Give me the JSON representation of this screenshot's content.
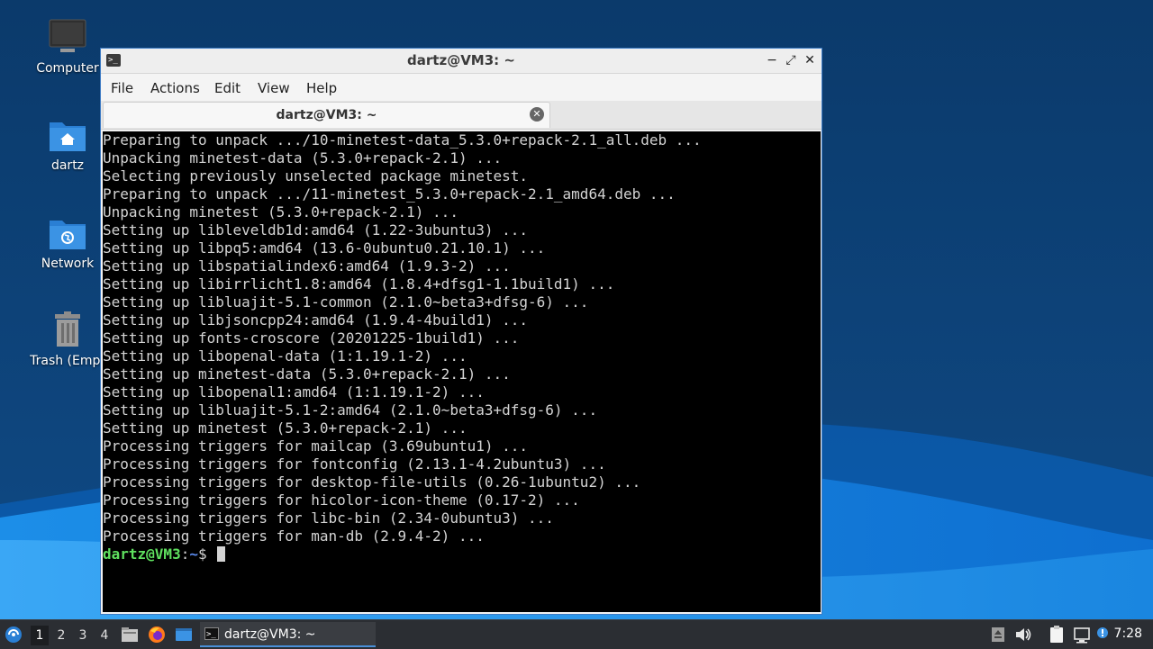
{
  "desktop": {
    "icons": [
      {
        "label": "Computer",
        "icon": "computer-icon"
      },
      {
        "label": "dartz",
        "icon": "home-folder-icon"
      },
      {
        "label": "Network",
        "icon": "network-folder-icon"
      },
      {
        "label": "Trash (Empt",
        "icon": "trash-icon"
      }
    ]
  },
  "window": {
    "title": "dartz@VM3: ~",
    "controls": {
      "minimize": "−",
      "maximize": "⤢",
      "close": "✕"
    },
    "menu": [
      "File",
      "Actions",
      "Edit",
      "View",
      "Help"
    ],
    "tab": {
      "label": "dartz@VM3: ~",
      "close": "✕"
    },
    "terminal": {
      "lines": [
        "Preparing to unpack .../10-minetest-data_5.3.0+repack-2.1_all.deb ...",
        "Unpacking minetest-data (5.3.0+repack-2.1) ...",
        "Selecting previously unselected package minetest.",
        "Preparing to unpack .../11-minetest_5.3.0+repack-2.1_amd64.deb ...",
        "Unpacking minetest (5.3.0+repack-2.1) ...",
        "Setting up libleveldb1d:amd64 (1.22-3ubuntu3) ...",
        "Setting up libpq5:amd64 (13.6-0ubuntu0.21.10.1) ...",
        "Setting up libspatialindex6:amd64 (1.9.3-2) ...",
        "Setting up libirrlicht1.8:amd64 (1.8.4+dfsg1-1.1build1) ...",
        "Setting up libluajit-5.1-common (2.1.0~beta3+dfsg-6) ...",
        "Setting up libjsoncpp24:amd64 (1.9.4-4build1) ...",
        "Setting up fonts-croscore (20201225-1build1) ...",
        "Setting up libopenal-data (1:1.19.1-2) ...",
        "Setting up minetest-data (5.3.0+repack-2.1) ...",
        "Setting up libopenal1:amd64 (1:1.19.1-2) ...",
        "Setting up libluajit-5.1-2:amd64 (2.1.0~beta3+dfsg-6) ...",
        "Setting up minetest (5.3.0+repack-2.1) ...",
        "Processing triggers for mailcap (3.69ubuntu1) ...",
        "Processing triggers for fontconfig (2.13.1-4.2ubuntu3) ...",
        "Processing triggers for desktop-file-utils (0.26-1ubuntu2) ...",
        "Processing triggers for hicolor-icon-theme (0.17-2) ...",
        "Processing triggers for libc-bin (2.34-0ubuntu3) ...",
        "Processing triggers for man-db (2.9.4-2) ..."
      ],
      "prompt": {
        "user_host": "dartz@VM3",
        "sep": ":",
        "path": "~",
        "symbol": "$ "
      }
    }
  },
  "taskbar": {
    "workspaces": [
      "1",
      "2",
      "3",
      "4"
    ],
    "active_workspace": "1",
    "task": {
      "label": "dartz@VM3: ~"
    },
    "clock": "7:28"
  },
  "colors": {
    "accent": "#4a90d9",
    "prompt_user": "#5fe05f",
    "prompt_path": "#5c8cf0",
    "terminal_bg": "#000000",
    "terminal_fg": "#d3d3d3"
  }
}
